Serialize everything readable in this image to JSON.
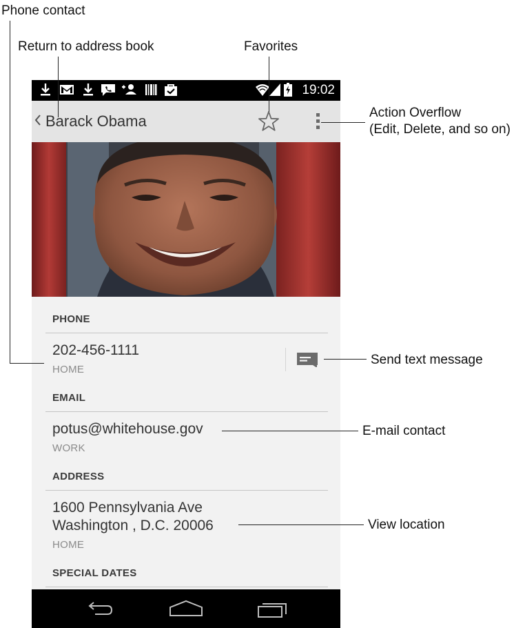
{
  "callouts": {
    "phone_contact": "Phone contact",
    "return_to_address_book": "Return to address book",
    "favorites": "Favorites",
    "action_overflow_line1": "Action Overflow",
    "action_overflow_line2": "(Edit, Delete, and so on)",
    "send_text_message": "Send text message",
    "email_contact": "E-mail contact",
    "view_location": "View location"
  },
  "status_bar": {
    "time": "19:02",
    "icons": [
      "download-icon",
      "gmail-icon",
      "download-icon",
      "hangouts-icon",
      "add-contact-icon",
      "barcode-icon",
      "shopping-bag-icon",
      "wifi-icon",
      "signal-icon",
      "battery-charging-icon"
    ]
  },
  "action_bar": {
    "contact_name": "Barack Obama",
    "icons": [
      "back-chevron-icon",
      "star-outline-icon",
      "overflow-menu-icon"
    ]
  },
  "sections": {
    "phone": {
      "header": "PHONE",
      "number": "202-456-1111",
      "type": "HOME"
    },
    "email": {
      "header": "EMAIL",
      "address": "potus@whitehouse.gov",
      "type": "WORK"
    },
    "address": {
      "header": "ADDRESS",
      "line1": "1600 Pennsylvania Ave",
      "line2": "Washington , D.C. 20006",
      "type": "HOME"
    },
    "special_dates": {
      "header": "SPECIAL DATES"
    }
  },
  "nav_bar": {
    "icons": [
      "back-icon",
      "home-icon",
      "recent-apps-icon"
    ]
  },
  "colors": {
    "status_bar": "#000000",
    "action_bar": "#e4e4e4",
    "details_bg": "#f2f2f2",
    "nav_bar": "#000000"
  }
}
